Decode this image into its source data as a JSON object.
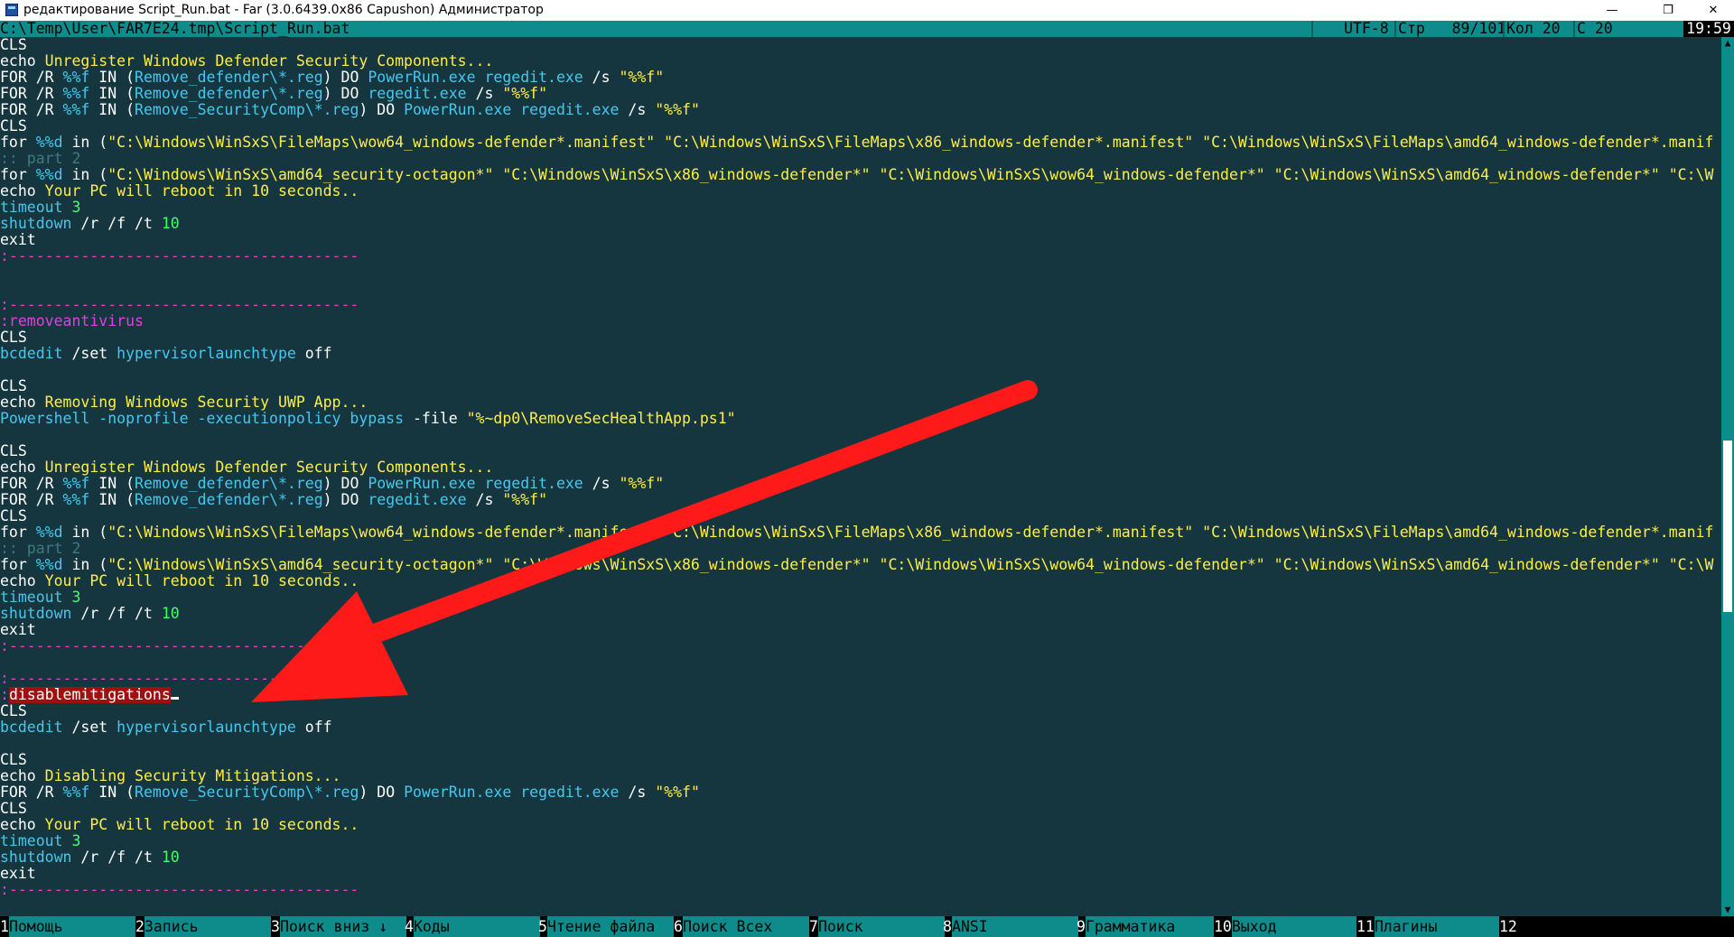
{
  "window": {
    "title": "редактирование Script_Run.bat - Far (3.0.6439.0x86 Capushon) Администратор",
    "minimize": "—",
    "maximize": "❐",
    "close": "✕"
  },
  "status": {
    "path": "C:\\Temp\\User\\FAR7E24.tmp\\Script_Run.bat",
    "encoding": "UTF-8",
    "line": "Стр   89/101",
    "col": "Кол 20",
    "char": "С 20",
    "clock": "19:59"
  },
  "editor": {
    "lines": [
      [
        [
          "CLS",
          "w"
        ]
      ],
      [
        [
          "echo ",
          "w"
        ],
        [
          "Unregister Windows Defender Security Components...",
          "y"
        ]
      ],
      [
        [
          "FOR /R ",
          "w"
        ],
        [
          "%%f",
          "c"
        ],
        [
          " IN (",
          "w"
        ],
        [
          "Remove_defender\\*.reg",
          "c"
        ],
        [
          ") DO ",
          "w"
        ],
        [
          "PowerRun.exe regedit.exe",
          "c"
        ],
        [
          " /s ",
          "w"
        ],
        [
          "\"%%f\"",
          "y"
        ]
      ],
      [
        [
          "FOR /R ",
          "w"
        ],
        [
          "%%f",
          "c"
        ],
        [
          " IN (",
          "w"
        ],
        [
          "Remove_defender\\*.reg",
          "c"
        ],
        [
          ") DO ",
          "w"
        ],
        [
          "regedit.exe",
          "c"
        ],
        [
          " /s ",
          "w"
        ],
        [
          "\"%%f\"",
          "y"
        ]
      ],
      [
        [
          "FOR /R ",
          "w"
        ],
        [
          "%%f",
          "c"
        ],
        [
          " IN (",
          "w"
        ],
        [
          "Remove_SecurityComp\\*.reg",
          "c"
        ],
        [
          ") DO ",
          "w"
        ],
        [
          "PowerRun.exe regedit.exe",
          "c"
        ],
        [
          " /s ",
          "w"
        ],
        [
          "\"%%f\"",
          "y"
        ]
      ],
      [
        [
          "CLS",
          "w"
        ]
      ],
      [
        [
          "for ",
          "w"
        ],
        [
          "%%d",
          "c"
        ],
        [
          " in (",
          "w"
        ],
        [
          "\"C:\\Windows\\WinSxS\\FileMaps\\wow64_windows-defender*.manifest\" \"C:\\Windows\\WinSxS\\FileMaps\\x86_windows-defender*.manifest\" \"C:\\Windows\\WinSxS\\FileMaps\\amd64_windows-defender*.manif",
          "y"
        ]
      ],
      [
        [
          ":: part 2",
          "k"
        ]
      ],
      [
        [
          "for ",
          "w"
        ],
        [
          "%%d",
          "c"
        ],
        [
          " in (",
          "w"
        ],
        [
          "\"C:\\Windows\\WinSxS\\amd64_security-octagon*\" \"C:\\Windows\\WinSxS\\x86_windows-defender*\" \"C:\\Windows\\WinSxS\\wow64_windows-defender*\" \"C:\\Windows\\WinSxS\\amd64_windows-defender*\" \"C:\\W",
          "y"
        ]
      ],
      [
        [
          "echo ",
          "w"
        ],
        [
          "Your PC will reboot in 10 seconds..",
          "y"
        ]
      ],
      [
        [
          "timeout ",
          "c"
        ],
        [
          "3",
          "g"
        ]
      ],
      [
        [
          "shutdown ",
          "c"
        ],
        [
          "/r /f /t ",
          "w"
        ],
        [
          "10",
          "g"
        ]
      ],
      [
        [
          "exit",
          "w"
        ]
      ],
      [
        [
          ":---------------------------------------",
          "l"
        ]
      ],
      [
        [
          "",
          "w"
        ]
      ],
      [
        [
          "",
          "w"
        ]
      ],
      [
        [
          ":---------------------------------------",
          "l"
        ]
      ],
      [
        [
          ":removeantivirus",
          "m"
        ]
      ],
      [
        [
          "CLS",
          "w"
        ]
      ],
      [
        [
          "bcdedit",
          "c"
        ],
        [
          " /set ",
          "w"
        ],
        [
          "hypervisorlaunchtype",
          "c"
        ],
        [
          " off",
          "w"
        ]
      ],
      [
        [
          "",
          "w"
        ]
      ],
      [
        [
          "CLS",
          "w"
        ]
      ],
      [
        [
          "echo ",
          "w"
        ],
        [
          "Removing Windows Security UWP App...",
          "y"
        ]
      ],
      [
        [
          "Powershell -noprofile -executionpolicy bypass",
          "c"
        ],
        [
          " -file ",
          "w"
        ],
        [
          "\"%~dp0\\RemoveSecHealthApp.ps1\"",
          "y"
        ]
      ],
      [
        [
          "",
          "w"
        ]
      ],
      [
        [
          "CLS",
          "w"
        ]
      ],
      [
        [
          "echo ",
          "w"
        ],
        [
          "Unregister Windows Defender Security Components...",
          "y"
        ]
      ],
      [
        [
          "FOR /R ",
          "w"
        ],
        [
          "%%f",
          "c"
        ],
        [
          " IN (",
          "w"
        ],
        [
          "Remove_defender\\*.reg",
          "c"
        ],
        [
          ") DO ",
          "w"
        ],
        [
          "PowerRun.exe regedit.exe",
          "c"
        ],
        [
          " /s ",
          "w"
        ],
        [
          "\"%%f\"",
          "y"
        ]
      ],
      [
        [
          "FOR /R ",
          "w"
        ],
        [
          "%%f",
          "c"
        ],
        [
          " IN (",
          "w"
        ],
        [
          "Remove_defender\\*.reg",
          "c"
        ],
        [
          ") DO ",
          "w"
        ],
        [
          "regedit.exe",
          "c"
        ],
        [
          " /s ",
          "w"
        ],
        [
          "\"%%f\"",
          "y"
        ]
      ],
      [
        [
          "CLS",
          "w"
        ]
      ],
      [
        [
          "for ",
          "w"
        ],
        [
          "%%d",
          "c"
        ],
        [
          " in (",
          "w"
        ],
        [
          "\"C:\\Windows\\WinSxS\\FileMaps\\wow64_windows-defender*.manifest\" \"C:\\Windows\\WinSxS\\FileMaps\\x86_windows-defender*.manifest\" \"C:\\Windows\\WinSxS\\FileMaps\\amd64_windows-defender*.manif",
          "y"
        ]
      ],
      [
        [
          ":: part 2",
          "k"
        ]
      ],
      [
        [
          "for ",
          "w"
        ],
        [
          "%%d",
          "c"
        ],
        [
          " in (",
          "w"
        ],
        [
          "\"C:\\Windows\\WinSxS\\amd64_security-octagon*\" \"C:\\Windows\\WinSxS\\x86_windows-defender*\" \"C:\\Windows\\WinSxS\\wow64_windows-defender*\" \"C:\\Windows\\WinSxS\\amd64_windows-defender*\" \"C:\\W",
          "y"
        ]
      ],
      [
        [
          "echo ",
          "w"
        ],
        [
          "Your PC will reboot in 10 seconds..",
          "y"
        ]
      ],
      [
        [
          "timeout ",
          "c"
        ],
        [
          "3",
          "g"
        ]
      ],
      [
        [
          "shutdown ",
          "c"
        ],
        [
          "/r /f /t ",
          "w"
        ],
        [
          "10",
          "g"
        ]
      ],
      [
        [
          "exit",
          "w"
        ]
      ],
      [
        [
          ":---------------------------------------",
          "l"
        ]
      ],
      [
        [
          "",
          "w"
        ]
      ],
      [
        [
          ":---------------------------------------",
          "l"
        ]
      ],
      [
        [
          ":",
          "m"
        ],
        [
          "disablemitigations",
          "sel"
        ],
        [
          "",
          "cursor"
        ]
      ],
      [
        [
          "CLS",
          "w"
        ]
      ],
      [
        [
          "bcdedit",
          "c"
        ],
        [
          " /set ",
          "w"
        ],
        [
          "hypervisorlaunchtype",
          "c"
        ],
        [
          " off",
          "w"
        ]
      ],
      [
        [
          "",
          "w"
        ]
      ],
      [
        [
          "CLS",
          "w"
        ]
      ],
      [
        [
          "echo ",
          "w"
        ],
        [
          "Disabling Security Mitigations...",
          "y"
        ]
      ],
      [
        [
          "FOR /R ",
          "w"
        ],
        [
          "%%f",
          "c"
        ],
        [
          " IN (",
          "w"
        ],
        [
          "Remove_SecurityComp\\*.reg",
          "c"
        ],
        [
          ") DO ",
          "w"
        ],
        [
          "PowerRun.exe regedit.exe",
          "c"
        ],
        [
          " /s ",
          "w"
        ],
        [
          "\"%%f\"",
          "y"
        ]
      ],
      [
        [
          "CLS",
          "w"
        ]
      ],
      [
        [
          "echo ",
          "w"
        ],
        [
          "Your PC will reboot in 10 seconds..",
          "y"
        ]
      ],
      [
        [
          "timeout ",
          "c"
        ],
        [
          "3",
          "g"
        ]
      ],
      [
        [
          "shutdown ",
          "c"
        ],
        [
          "/r /f /t ",
          "w"
        ],
        [
          "10",
          "g"
        ]
      ],
      [
        [
          "exit",
          "w"
        ]
      ],
      [
        [
          ":---------------------------------------",
          "l"
        ]
      ]
    ]
  },
  "keybar": [
    {
      "num": "1",
      "label": "Помощь"
    },
    {
      "num": "2",
      "label": "Запись"
    },
    {
      "num": "3",
      "label": "Поиск вниз ↓"
    },
    {
      "num": "4",
      "label": "Коды"
    },
    {
      "num": "5",
      "label": "Чтение файла"
    },
    {
      "num": "6",
      "label": "Поиск Всех"
    },
    {
      "num": "7",
      "label": "Поиск"
    },
    {
      "num": "8",
      "label": "ANSI"
    },
    {
      "num": "9",
      "label": "Грамматика"
    },
    {
      "num": "10",
      "label": "Выход"
    },
    {
      "num": "11",
      "label": "Плагины"
    },
    {
      "num": "12",
      "label": ""
    }
  ],
  "colors": {
    "background": "#16363f",
    "statusbar": "#0e8c8c",
    "annotation_arrow": "#ff1a1a",
    "selection": "#a01010"
  },
  "annotation": {
    "type": "arrow",
    "icon": "red-arrow"
  }
}
